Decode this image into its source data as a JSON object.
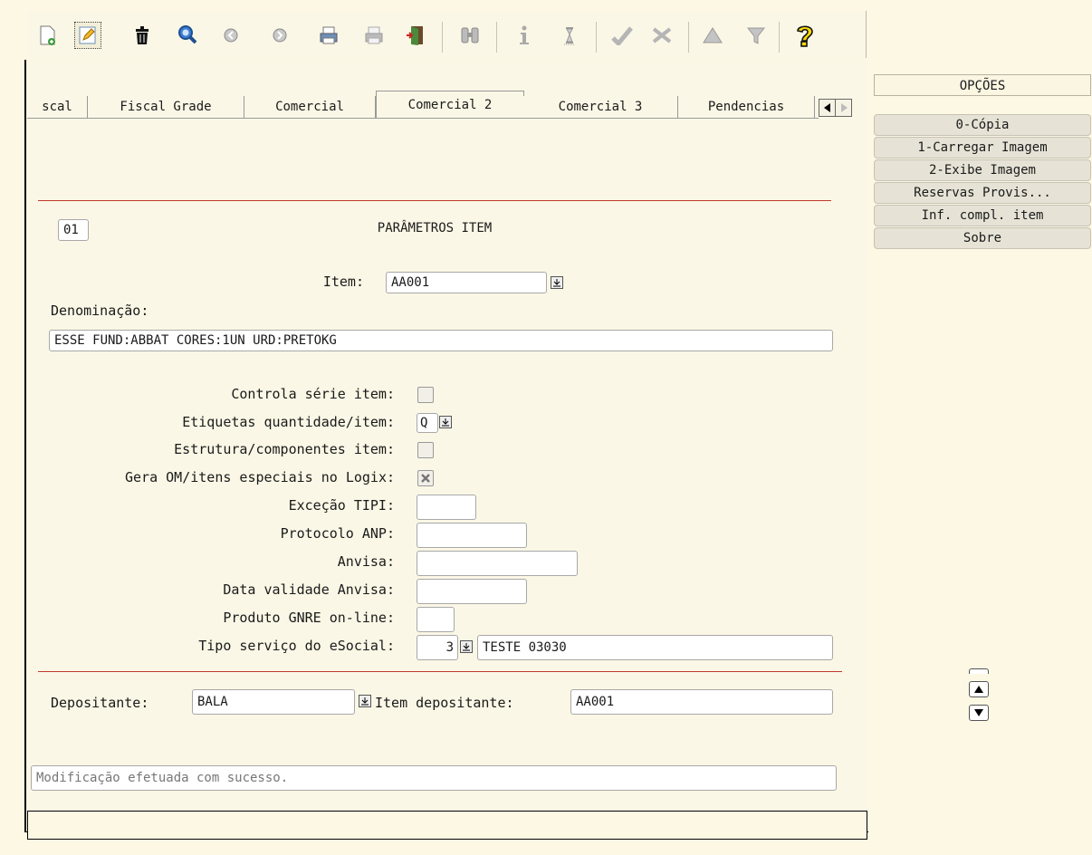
{
  "toolbar": {
    "buttons": [
      {
        "icon": "new-document-icon"
      },
      {
        "icon": "edit-pencil-icon",
        "selected": true
      },
      {
        "icon": "trash-icon"
      },
      {
        "icon": "search-magnifier-icon"
      },
      {
        "icon": "previous-record-icon"
      },
      {
        "icon": "next-record-icon"
      },
      {
        "icon": "print-icon"
      },
      {
        "icon": "print-disabled-icon"
      },
      {
        "icon": "exit-door-icon"
      },
      {
        "icon": "binoculars-icon"
      },
      {
        "icon": "info-icon"
      },
      {
        "icon": "hourglass-icon"
      },
      {
        "icon": "confirm-check-icon"
      },
      {
        "icon": "cancel-x-icon"
      },
      {
        "icon": "triangle-up-icon"
      },
      {
        "icon": "filter-icon"
      },
      {
        "icon": "help-question-icon"
      }
    ]
  },
  "tabs": [
    {
      "label": "scal"
    },
    {
      "label": "Fiscal Grade"
    },
    {
      "label": "Comercial"
    },
    {
      "label": "Comercial 2",
      "active": true
    },
    {
      "label": "Comercial 3"
    },
    {
      "label": "Pendencias"
    }
  ],
  "form": {
    "code": "01",
    "section_title": "PARÂMETROS ITEM",
    "item_label": "Item:",
    "item_value": "AA001",
    "denominacao_label": "Denominação:",
    "denominacao_value": "ESSE FUND:ABBAT CORES:1UN URD:PRETOKG",
    "controla_serie_label": "Controla série item:",
    "controla_serie_checked": false,
    "etiquetas_label": "Etiquetas quantidade/item:",
    "etiquetas_value": "Q",
    "estrutura_label": "Estrutura/componentes item:",
    "estrutura_checked": false,
    "gera_om_label": "Gera OM/itens especiais no Logix:",
    "gera_om_checked": true,
    "excecao_tipi_label": "Exceção TIPI:",
    "excecao_tipi_value": "",
    "protocolo_anp_label": "Protocolo ANP:",
    "protocolo_anp_value": "",
    "anvisa_label": "Anvisa:",
    "anvisa_value": "",
    "data_validade_label": "Data validade Anvisa:",
    "data_validade_value": "",
    "produto_gnre_label": "Produto GNRE on-line:",
    "produto_gnre_value": "",
    "tipo_servico_label": "Tipo serviço do eSocial:",
    "tipo_servico_code": "3",
    "tipo_servico_desc": "TESTE 03030",
    "depositante_label": "Depositante:",
    "depositante_value": "BALA",
    "item_depositante_label": "Item depositante:",
    "item_depositante_value": "AA001"
  },
  "status": {
    "message": "Modificação efetuada com sucesso."
  },
  "options": {
    "title": "OPÇÕES",
    "items": [
      {
        "label": "0-Cópia"
      },
      {
        "label": "1-Carregar Imagem"
      },
      {
        "label": "2-Exibe Imagem"
      },
      {
        "label": "Reservas Provis..."
      },
      {
        "label": "Inf. compl. item"
      },
      {
        "label": "Sobre"
      }
    ]
  },
  "colors": {
    "background": "#fcf8e4",
    "separator_red": "#c0392b"
  }
}
